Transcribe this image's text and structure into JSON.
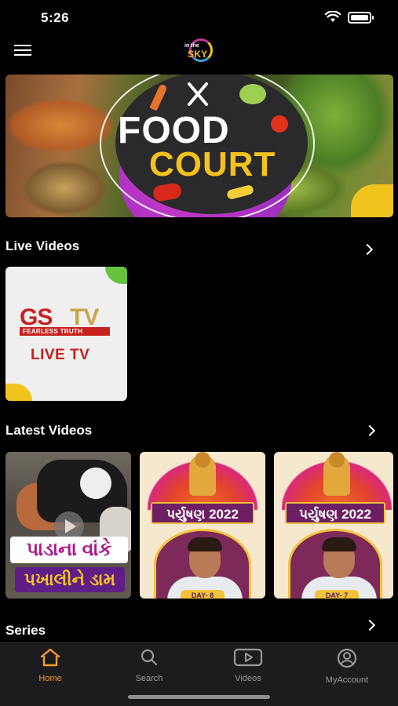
{
  "status_bar": {
    "time": "5:26"
  },
  "header": {
    "logo_top": "in the",
    "logo_bottom": "SKY"
  },
  "hero": {
    "title_line1": "FOOD",
    "title_line2": "COURT"
  },
  "sections": {
    "live": {
      "title": "Live Videos"
    },
    "latest": {
      "title": "Latest Videos"
    },
    "series": {
      "title": "Series"
    }
  },
  "live_videos": [
    {
      "brand_left": "GS",
      "brand_right": "TV",
      "tagline": "FEARLESS TRUTH",
      "label": "LIVE TV"
    }
  ],
  "latest_videos": [
    {
      "caption_line1": "પાડાના વાંકે",
      "caption_line2": "પખાલીને ડામ"
    },
    {
      "banner": "પર્યુષણ 2022",
      "day": "DAY- 8"
    },
    {
      "banner": "પર્યુષણ 2022",
      "day": "DAY- 7"
    }
  ],
  "tabbar": {
    "items": [
      {
        "label": "Home",
        "icon": "home-icon",
        "active": true
      },
      {
        "label": "Search",
        "icon": "search-icon",
        "active": false
      },
      {
        "label": "Videos",
        "icon": "video-icon",
        "active": false
      },
      {
        "label": "MyAccount",
        "icon": "account-icon",
        "active": false
      }
    ],
    "active_color": "#f39c2b",
    "inactive_color": "#9a9a9a"
  }
}
